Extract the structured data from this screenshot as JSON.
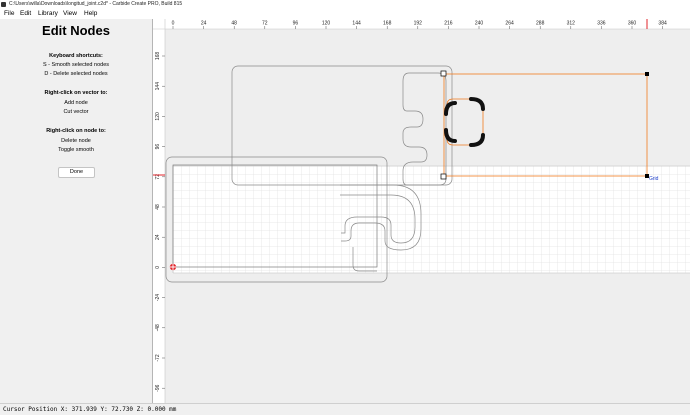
{
  "window": {
    "title": "C:\\Users\\willa\\Downloads\\longitud_joint.c2d* - Carbide Create PRO, Build 815"
  },
  "menu": [
    "File",
    "Edit",
    "Library",
    "View",
    "Help"
  ],
  "sidebar": {
    "title": "Edit Nodes",
    "sections": [
      {
        "heading": "Keyboard shortcuts:",
        "lines": [
          "S - Smooth selected nodes",
          "D - Delete selected nodes"
        ]
      },
      {
        "heading": "Right-click on vector to:",
        "lines": [
          "Add node",
          "Cut vector"
        ]
      },
      {
        "heading": "Right-click on node to:",
        "lines": [
          "Delete node",
          "Toggle smooth"
        ]
      }
    ],
    "done_label": "Done"
  },
  "ruler": {
    "x_labels": [
      "0",
      "24",
      "48",
      "72",
      "96",
      "120",
      "144",
      "168",
      "192",
      "216",
      "240",
      "264",
      "288",
      "312",
      "336",
      "360",
      "384"
    ],
    "y_labels": [
      "168",
      "144",
      "120",
      "96",
      "72",
      "48",
      "24",
      "0",
      "-24",
      "-48",
      "-72",
      "-96"
    ]
  },
  "canvas": {
    "grid_label": "Grid",
    "colors": {
      "background": "#eeeeee",
      "grid_fill": "#ffffff",
      "grid_line": "#d6d6d6",
      "vector": "#8a8a8a",
      "selected_vector": "#f07a1e",
      "cursor_marker": "#e0242b",
      "grid_label": "#1a3cc8"
    }
  },
  "status": {
    "text": "Cursor Position X: 371.939 Y: 72.730 Z: 0.000 mm"
  }
}
